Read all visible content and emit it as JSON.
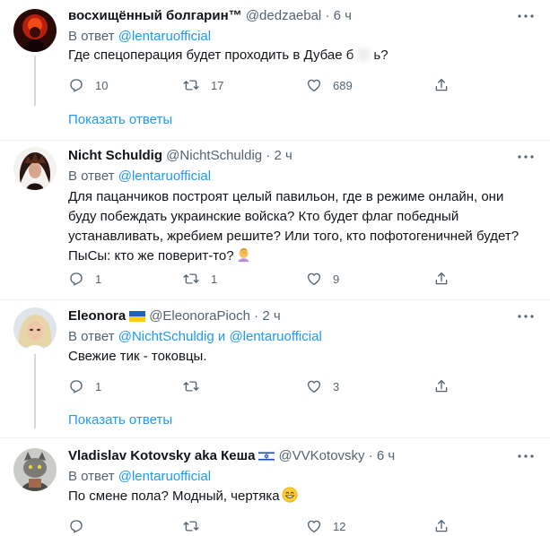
{
  "colors": {
    "accent": "#1d9bf0",
    "text": "#0f1419",
    "muted": "#536471",
    "divider": "#eff3f4"
  },
  "show_replies_label": "Показать ответы",
  "tweets": [
    {
      "display_name": "восхищённый болгарин™",
      "handle": "@dedzaebal",
      "dot": "·",
      "time": "6 ч",
      "reply_prefix": "В ответ",
      "reply_to": "@lentaruofficial",
      "text_before": "Где спецоперация будет проходить в Дубае б",
      "text_after": "ь?",
      "replies": "10",
      "retweets": "17",
      "likes": "689"
    },
    {
      "display_name": "Nicht Schuldig",
      "handle": "@NichtSchuldig",
      "dot": "·",
      "time": "2 ч",
      "reply_prefix": "В ответ",
      "reply_to": "@lentaruofficial",
      "text": "Для пацанчиков построят целый павильон, где в режиме онлайн, они буду побеждать украинские войска? Кто будет флаг победный устанавливать, жребием решите? Или того, кто пофотогеничней будет? ПыСы: кто же поверит-то?",
      "replies": "1",
      "retweets": "1",
      "likes": "9"
    },
    {
      "display_name": "Eleonora",
      "handle": "@EleonoraPioch",
      "dot": "·",
      "time": "2 ч",
      "reply_prefix": "В ответ",
      "reply_to_1": "@NichtSchuldig",
      "reply_conj": "и",
      "reply_to_2": "@lentaruofficial",
      "text": "Свежие тик - токовцы.",
      "replies": "1",
      "retweets": "",
      "likes": "3"
    },
    {
      "display_name": "Vladislav Kotovsky aka Кеша",
      "handle": "@VVKotovsky",
      "dot": "·",
      "time": "6 ч",
      "reply_prefix": "В ответ",
      "reply_to": "@lentaruofficial",
      "text": "По смене пола? Модный, чертяка",
      "replies": "",
      "retweets": "",
      "likes": "12"
    }
  ]
}
